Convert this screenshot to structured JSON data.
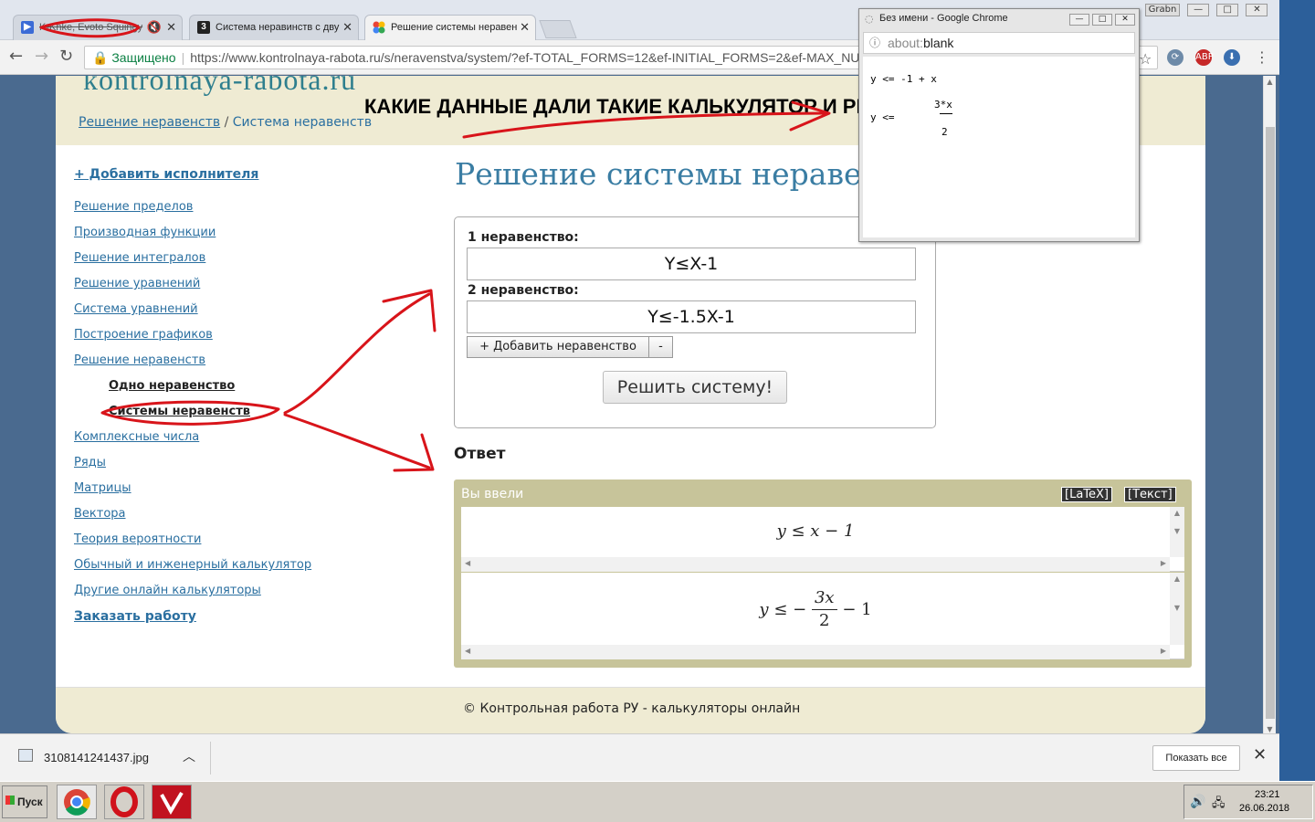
{
  "browser": {
    "tabs": [
      {
        "label": "K-Knke, Evoto Squingy",
        "favicon": "play-icon",
        "muted": "🔇"
      },
      {
        "label": "Система неравинств с дву",
        "favicon": "3"
      },
      {
        "label": "Решение системы неравен",
        "favicon": "google-icon"
      }
    ],
    "address": {
      "secure_label": "Защищено",
      "url": "https://www.kontrolnaya-rabota.ru/s/neravenstva/system/?ef-TOTAL_FORMS=12&ef-INITIAL_FORMS=2&ef-MAX_NUM_"
    },
    "window_label": "Grabn"
  },
  "site": {
    "logo": "kontrolnaya-rabota.ru",
    "breadcrumb": {
      "parent": "Решение неравенств",
      "separator": "/",
      "current": "Система неравенств"
    },
    "add_performer": "+ Добавить исполнителя",
    "nav": [
      {
        "label": "Решение пределов"
      },
      {
        "label": "Производная функции"
      },
      {
        "label": "Решение интегралов"
      },
      {
        "label": "Решение уравнений"
      },
      {
        "label": "Система уравнений"
      },
      {
        "label": "Построение графиков"
      },
      {
        "label": "Решение неравенств"
      },
      {
        "label": "Одно неравенство",
        "sub": true
      },
      {
        "label": "Системы неравенств",
        "sub": true
      },
      {
        "label": "Комплексные числа"
      },
      {
        "label": "Ряды"
      },
      {
        "label": "Матрицы"
      },
      {
        "label": "Вектора"
      },
      {
        "label": "Теория вероятности"
      },
      {
        "label": "Обычный и инженерный калькулятор"
      },
      {
        "label": "Другие онлайн калькуляторы"
      },
      {
        "label": "Заказать работу",
        "strong": true
      }
    ],
    "title": "Решение системы неравенс",
    "form": {
      "label1": "1 неравенство:",
      "value1": "Y≤X-1",
      "label2": "2 неравенство:",
      "value2": "Y≤-1.5X-1",
      "add_button": "+ Добавить неравенство",
      "remove_button": "-",
      "solve_button": "Решить систему!"
    },
    "answer": {
      "heading": "Ответ",
      "entered_label": "Вы ввели",
      "latex_button": "[LaTeX]",
      "text_button": "[Текст]",
      "expr1": {
        "lhs": "y",
        "rel": "≤",
        "rhs": "x − 1"
      },
      "expr2": {
        "lhs": "y",
        "rel": "≤",
        "neg": "−",
        "num": "3x",
        "den": "2",
        "tail": "− 1"
      }
    },
    "footer": "© Контрольная работа РУ - калькуляторы онлайн"
  },
  "annotation": {
    "text": "КАКИЕ ДАННЫЕ ДАЛИ ТАКИЕ КАЛЬКУЛЯТОР И РЕШИЛ",
    "color": "#d8141a"
  },
  "popup": {
    "title": "Без имени - Google Chrome",
    "url_scheme": "about:",
    "url_path": "blank",
    "line1": "y <= -1 + x",
    "line2_num": "3*x",
    "line2_prefix": "y <=",
    "line2_den": "2"
  },
  "downloads": {
    "file": "3108141241437.jpg",
    "show_all": "Показать все"
  },
  "taskbar": {
    "start": "Пуск",
    "time": "23:21",
    "date": "26.06.2018"
  }
}
